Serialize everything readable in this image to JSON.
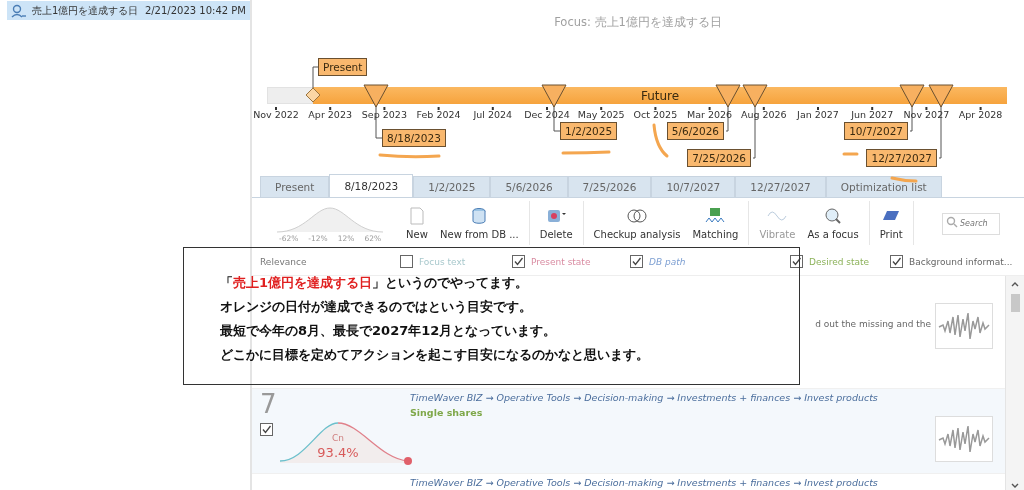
{
  "sidebar": {
    "items": [
      {
        "title": "売上1億円を達成する日",
        "date": "2/21/2023 10:42 PM",
        "selected": true
      }
    ]
  },
  "focus_title": "Focus: 売上1億円を達成する日",
  "timeline": {
    "bar_label": "Future",
    "axis_labels": [
      "Nov 2022",
      "Apr 2023",
      "Sep 2023",
      "Feb 2024",
      "Jul 2024",
      "Dec 2024",
      "May 2025",
      "Oct 2025",
      "Mar 2026",
      "Aug 2026",
      "Jan 2027",
      "Jun 2027",
      "Nov 2027",
      "Apr 2028"
    ],
    "markers": [
      {
        "kind": "present",
        "label": "Present"
      },
      {
        "kind": "target",
        "label": "8/18/2023"
      },
      {
        "kind": "target",
        "label": "1/2/2025"
      },
      {
        "kind": "target",
        "label": "5/6/2026"
      },
      {
        "kind": "target",
        "label": "7/25/2026"
      },
      {
        "kind": "target",
        "label": "10/7/2027"
      },
      {
        "kind": "target",
        "label": "12/27/2027"
      }
    ]
  },
  "tabs": [
    {
      "label": "Present",
      "selected": false
    },
    {
      "label": "8/18/2023",
      "selected": true
    },
    {
      "label": "1/2/2025",
      "selected": false
    },
    {
      "label": "5/6/2026",
      "selected": false
    },
    {
      "label": "7/25/2026",
      "selected": false
    },
    {
      "label": "10/7/2027",
      "selected": false
    },
    {
      "label": "12/27/2027",
      "selected": false
    },
    {
      "label": "Optimization list",
      "selected": false
    }
  ],
  "toolbar": {
    "distribution_labels": [
      "-62%",
      "-12%",
      "12%",
      "62%"
    ],
    "buttons": [
      {
        "kind": "new",
        "label": "New",
        "disabled": false
      },
      {
        "kind": "db",
        "label": "New from DB ...",
        "disabled": false
      },
      {
        "kind": "delete",
        "label": "Delete",
        "disabled": false
      },
      {
        "kind": "checkup",
        "label": "Checkup analysis",
        "disabled": false
      },
      {
        "kind": "matching",
        "label": "Matching",
        "disabled": false
      },
      {
        "kind": "vibrate",
        "label": "Vibrate",
        "disabled": true
      },
      {
        "kind": "focus",
        "label": "As a focus",
        "disabled": false
      },
      {
        "kind": "print",
        "label": "Print",
        "disabled": false
      }
    ],
    "search": {
      "placeholder": "Search"
    }
  },
  "columns": [
    {
      "kind": "plain",
      "label": "Relevance"
    },
    {
      "kind": "checkbox",
      "label": "Focus text",
      "checked": false,
      "color": "#a8c8cc"
    },
    {
      "kind": "checkbox",
      "label": "Present state",
      "checked": true,
      "color": "#d98ca2"
    },
    {
      "kind": "checkbox",
      "label": "DB path",
      "checked": true,
      "color": "#7d9fd2"
    },
    {
      "kind": "checkbox",
      "label": "Desired state",
      "checked": true,
      "color": "#8cb25a"
    },
    {
      "kind": "checkbox",
      "label": "Background informat...",
      "checked": true
    }
  ],
  "rows": [
    {
      "background_text": "d out the missing and the"
    },
    {
      "number": "7",
      "checked": true,
      "gauge_label": "Cn",
      "gauge_value": "93.4%",
      "db_path": "TimeWaver BIZ → Operative Tools → Decision-making → Investments + finances → Invest products",
      "desired_state": "Single shares"
    },
    {
      "db_path": "TimeWaver BIZ → Operative Tools → Decision-making → Investments + finances → Invest products"
    }
  ],
  "note": {
    "lines": [
      [
        {
          "text": "「",
          "emphasis": false
        },
        {
          "text": "売上1億円を達成する日",
          "emphasis": true
        },
        {
          "text": "」というのでやってます。",
          "emphasis": false
        }
      ],
      [
        {
          "text": "オレンジの日付が達成できるのではという目安です。",
          "emphasis": false
        }
      ],
      [
        {
          "text": "最短で今年の8月、最長で2027年12月となっています。",
          "emphasis": false
        }
      ],
      [
        {
          "text": "どこかに目標を定めてアクションを起こす目安になるのかなと思います。",
          "emphasis": false
        }
      ]
    ]
  }
}
